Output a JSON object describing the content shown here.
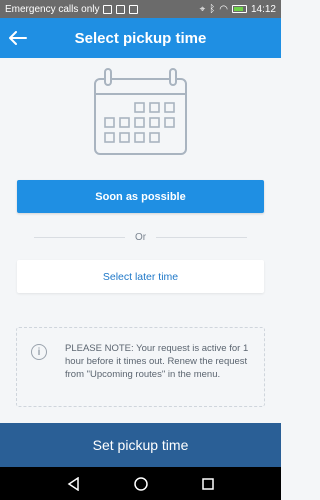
{
  "status_bar": {
    "carrier_text": "Emergency calls only",
    "time": "14:12",
    "icons": [
      "signal-icon",
      "sim-icon",
      "mail-icon",
      "photo-icon",
      "location-icon",
      "bluetooth-icon",
      "vibrate-icon",
      "wifi-icon",
      "no-sim-icon",
      "battery-icon"
    ]
  },
  "header": {
    "back_icon": "back-arrow-icon",
    "title": "Select pickup time"
  },
  "illustration": {
    "icon": "calendar-icon"
  },
  "options": {
    "primary_label": "Soon as possible",
    "divider_text": "Or",
    "secondary_label": "Select later time"
  },
  "note": {
    "icon": "info-icon",
    "text": "PLEASE NOTE: Your request is active for 1 hour before it times out. Renew the request from \"Upcoming routes\" in the menu."
  },
  "footer": {
    "action_label": "Set pickup time"
  },
  "system_nav": {
    "icons": [
      "back-triangle-icon",
      "home-circle-icon",
      "recents-square-icon"
    ]
  },
  "colors": {
    "accent": "#1f8fe3",
    "footer": "#2a5f96",
    "link": "#1f78c8"
  }
}
